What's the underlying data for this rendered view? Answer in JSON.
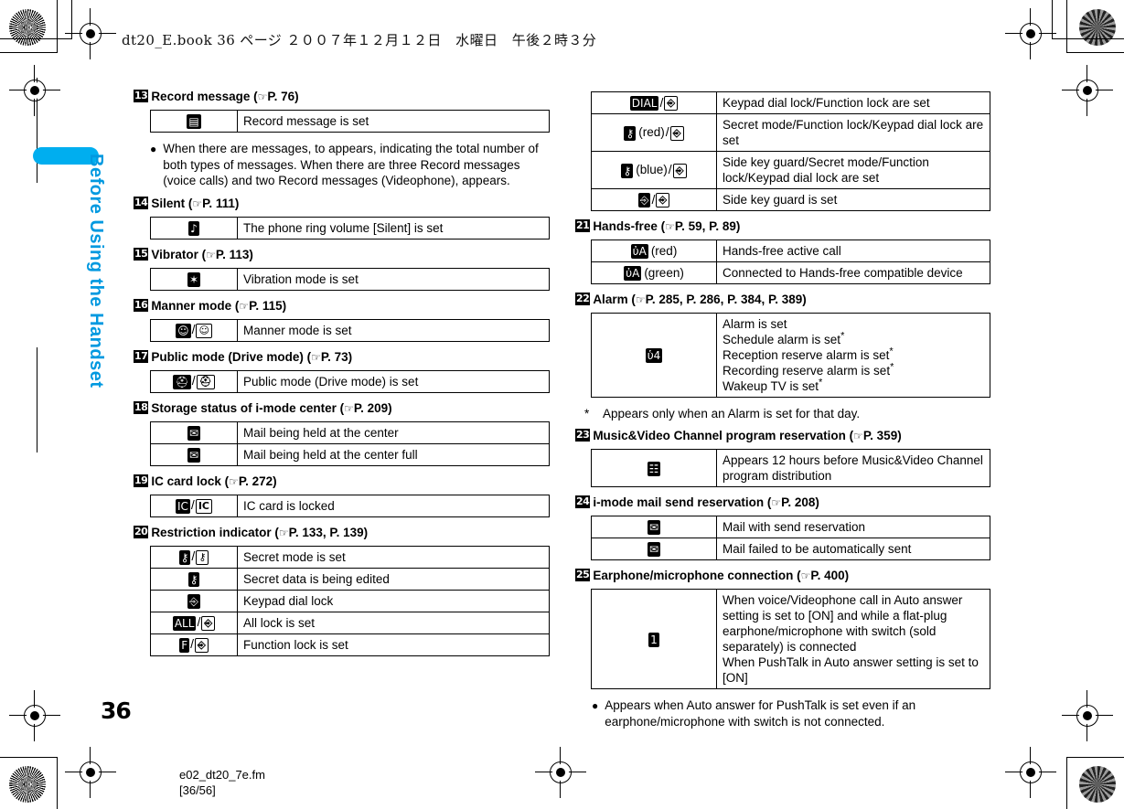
{
  "header": {
    "book_line": "dt20_E.book  36 ページ  ２００７年１２月１２日　水曜日　午後２時３分"
  },
  "sidebar": {
    "chapter_label": "Before Using the Handset",
    "tab_color": "#00AEEF"
  },
  "page": {
    "number": "36",
    "footer_file": "e02_dt20_7e.fm",
    "footer_pages": "[36/56]"
  },
  "left_column": {
    "sections": [
      {
        "num": "13",
        "title": "Record message (",
        "ref": "P. 76)",
        "rows": [
          {
            "icon": "record-message-icon",
            "glyph": "▤",
            "desc": "Record message is set"
          }
        ],
        "bullet": "When there are messages,  to  appears, indicating the total number of both types of messages. When there are three Record messages (voice calls) and two Record messages (Videophone),  appears."
      },
      {
        "num": "14",
        "title": "Silent (",
        "ref": "P. 111)",
        "rows": [
          {
            "icon": "silent-icon",
            "glyph": "♪",
            "desc": "The phone ring volume [Silent] is set"
          }
        ]
      },
      {
        "num": "15",
        "title": "Vibrator (",
        "ref": "P. 113)",
        "rows": [
          {
            "icon": "vibration-icon",
            "glyph": "✶",
            "desc": "Vibration mode is set"
          }
        ]
      },
      {
        "num": "16",
        "title": "Manner mode (",
        "ref": "P. 115)",
        "rows": [
          {
            "icon": "manner-mode-icon",
            "glyph": "☺",
            "glyph2": "☺",
            "desc": "Manner mode is set"
          }
        ]
      },
      {
        "num": "17",
        "title": "Public mode (Drive mode) (",
        "ref": "P. 73)",
        "rows": [
          {
            "icon": "drive-mode-icon",
            "glyph": "⛑",
            "glyph2": "⛑",
            "desc": "Public mode (Drive mode) is set"
          }
        ]
      },
      {
        "num": "18",
        "title": "Storage status of i-mode center (",
        "ref": "P. 209)",
        "rows": [
          {
            "icon": "mail-held-icon",
            "glyph": "✉",
            "desc": "Mail being held at the center"
          },
          {
            "icon": "mail-held-full-icon",
            "glyph": "✉",
            "desc": "Mail being held at the center full"
          }
        ]
      },
      {
        "num": "19",
        "title": "IC card lock (",
        "ref": "P. 272)",
        "rows": [
          {
            "icon": "ic-card-lock-icon",
            "glyph": "IC",
            "glyph2": "IC",
            "desc": "IC card is locked"
          }
        ]
      },
      {
        "num": "20",
        "title": "Restriction indicator (",
        "ref": "P. 133, P. 139)",
        "rows": [
          {
            "icon": "secret-mode-icon",
            "glyph": "⚷",
            "glyph2": "⚷",
            "desc": "Secret mode is set"
          },
          {
            "icon": "secret-data-edit-icon",
            "glyph": "⚷",
            "desc": "Secret data is being edited"
          },
          {
            "icon": "keypad-dial-lock-icon",
            "glyph": "⎆",
            "desc": "Keypad dial lock"
          },
          {
            "icon": "all-lock-icon",
            "glyph": "ALL",
            "glyph2": "⎆",
            "desc": "All lock is set"
          },
          {
            "icon": "function-lock-icon",
            "glyph": "F",
            "glyph2": "⎆",
            "desc": "Function lock is set"
          }
        ]
      }
    ]
  },
  "right_column": {
    "top_table_rows": [
      {
        "icon": "keypad-function-lock-icon",
        "glyph": "DIAL",
        "glyph2": "⎆",
        "desc": "Keypad dial lock/Function lock are set"
      },
      {
        "icon": "secret-function-keypad-lock-icon",
        "glyph": "⚷",
        "color_label": "(red)",
        "glyph2": "⎆",
        "desc": "Secret mode/Function lock/Keypad dial lock are set"
      },
      {
        "icon": "sidekey-secret-function-keypad-lock-icon",
        "glyph": "⚷",
        "color_label": "(blue)",
        "glyph2": "⎆",
        "desc": "Side key guard/Secret mode/Function lock/Keypad dial lock are set"
      },
      {
        "icon": "side-key-guard-icon",
        "glyph": "⎆",
        "glyph2": "⎆",
        "desc": "Side key guard is set"
      }
    ],
    "sections": [
      {
        "num": "21",
        "title": "Hands-free (",
        "ref": "P. 59, P. 89)",
        "rows": [
          {
            "icon": "hands-free-icon",
            "glyph": "ὐA",
            "color_label": "(red)",
            "desc": "Hands-free active call"
          },
          {
            "icon": "hands-free-icon",
            "glyph": "ὐA",
            "color_label": "(green)",
            "desc": "Connected to Hands-free compatible device"
          }
        ]
      },
      {
        "num": "22",
        "title": "Alarm (",
        "ref": "P. 285, P. 286, P. 384, P. 389)",
        "rows": [
          {
            "icon": "alarm-bell-icon",
            "glyph": "ὑ4",
            "desc_lines": [
              {
                "text": "Alarm is set",
                "asterisk": false
              },
              {
                "text": "Schedule alarm is set",
                "asterisk": true
              },
              {
                "text": "Reception reserve alarm is set",
                "asterisk": true
              },
              {
                "text": "Recording reserve alarm is set",
                "asterisk": true
              },
              {
                "text": "Wakeup TV is set",
                "asterisk": true
              }
            ]
          }
        ],
        "note": "Appears only when an Alarm is set for that day."
      },
      {
        "num": "23",
        "title": "Music&Video Channel program reservation (",
        "ref": "P. 359)",
        "rows": [
          {
            "icon": "music-video-channel-icon",
            "glyph": "☷",
            "desc": "Appears 12 hours before Music&Video Channel program distribution"
          }
        ]
      },
      {
        "num": "24",
        "title": "i-mode mail send reservation (",
        "ref": "P. 208)",
        "rows": [
          {
            "icon": "mail-send-reservation-icon",
            "glyph": "✉",
            "desc": "Mail with send reservation"
          },
          {
            "icon": "mail-send-failed-icon",
            "glyph": "✉",
            "desc": "Mail failed to be automatically sent"
          }
        ]
      },
      {
        "num": "25",
        "title": "Earphone/microphone connection (",
        "ref": "P. 400)",
        "rows": [
          {
            "icon": "earphone-mic-icon",
            "glyph": "὏1",
            "desc_lines": [
              {
                "text": "When voice/Videophone call in Auto answer setting is set to [ON] and while a flat-plug earphone/microphone with switch (sold separately) is connected",
                "asterisk": false
              },
              {
                "text": "When PushTalk in Auto answer setting is set to [ON]",
                "asterisk": false
              }
            ]
          }
        ],
        "bullet": "Appears when Auto answer for PushTalk is set even if an earphone/microphone with switch is not connected."
      }
    ]
  },
  "symbols": {
    "hand_ref": "☞",
    "bullet_dot": "●",
    "asterisk": "*",
    "slash": "/"
  }
}
